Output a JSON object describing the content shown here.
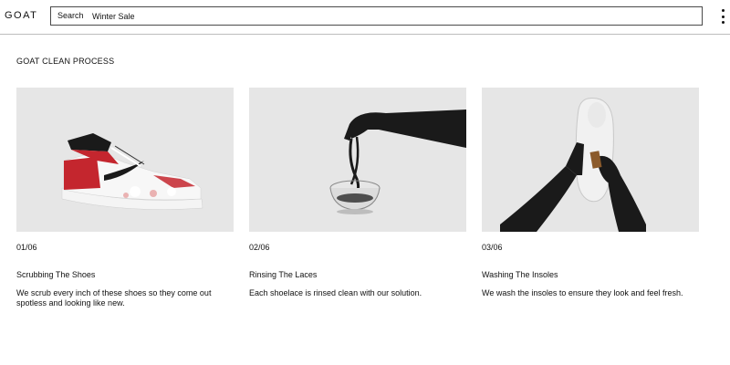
{
  "header": {
    "logo": "GOAT",
    "search_label": "Search",
    "search_value": "Winter Sale"
  },
  "main": {
    "section_title": "GOAT CLEAN PROCESS",
    "cards": [
      {
        "step": "01/06",
        "title": "Scrubbing The Shoes",
        "description": "We scrub every inch of these shoes so they come out spotless and looking like new."
      },
      {
        "step": "02/06",
        "title": "Rinsing The Laces",
        "description": "Each shoelace is rinsed clean with our solution."
      },
      {
        "step": "03/06",
        "title": "Washing The Insoles",
        "description": "We wash the insoles to ensure they look and feel fresh."
      }
    ]
  },
  "colors": {
    "image_background": "#e6e6e6",
    "sneaker_red": "#c4262e",
    "glove_black": "#1a1a1a"
  },
  "icons": [
    "more-vertical-icon"
  ]
}
